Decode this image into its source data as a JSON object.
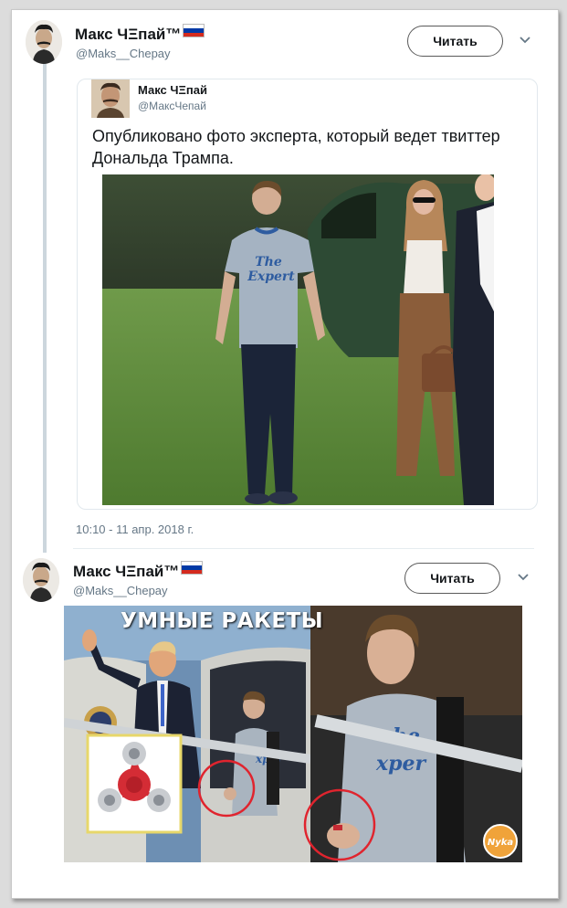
{
  "tweet1": {
    "author_name": "Макс ЧΞпай™",
    "author_handle": "@Maks__Chepay",
    "follow_label": "Читать",
    "quoted": {
      "author_name": "Макс ЧΞпай",
      "author_handle": "@МаксЧепай",
      "text": "Опубликовано фото эксперта, который ведет твиттер Дональда Трампа.",
      "photo_shirt_text": [
        "The",
        "Expert"
      ]
    },
    "timestamp": "10:10 - 11 апр. 2018 г."
  },
  "tweet2": {
    "author_name": "Макс ЧΞпай™",
    "author_handle": "@Maks__Chepay",
    "follow_label": "Читать",
    "meme_title": "УМНЫЕ РАКЕТЫ",
    "meme_shirt_text": [
      "he",
      "xper"
    ],
    "watermark": "Nyka"
  },
  "colors": {
    "handle": "#657786",
    "flag": [
      "#ffffff",
      "#0039a6",
      "#d52b1e"
    ]
  },
  "icons": {
    "menu": "chevron-down-icon",
    "flag": "russian-flag-icon"
  }
}
